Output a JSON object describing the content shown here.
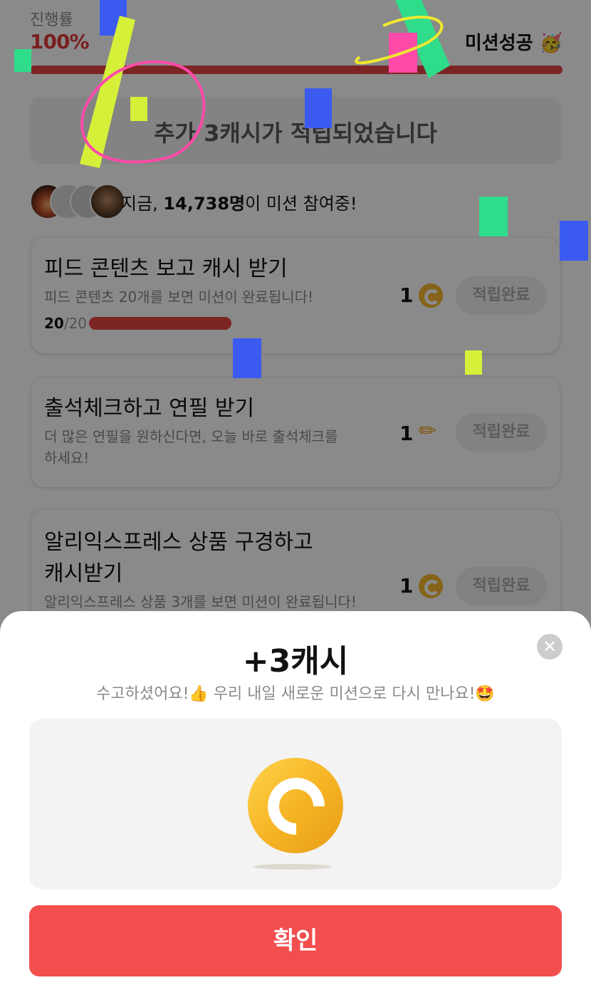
{
  "header": {
    "progress_label": "진행률",
    "progress_value": "100%",
    "progress_fraction": 1.0,
    "mission_status": "미션성공",
    "mission_status_emoji": "🥳"
  },
  "notice": {
    "text": "추가 3캐시가 적립되었습니다"
  },
  "participants": {
    "prefix": "지금, ",
    "count": "14,738명",
    "suffix": "이 미션 참여중!"
  },
  "missions": [
    {
      "title": "피드 콘텐츠 보고 캐시 받기",
      "description": "피드 콘텐츠 20개를 보면 미션이 완료됩니다!",
      "progress_done": "20",
      "progress_total": "/20",
      "progress_fraction": 1.0,
      "reward_amount": "1",
      "reward_icon": "cash-coin-icon",
      "button_label": "적립완료"
    },
    {
      "title": "출석체크하고 연필 받기",
      "description_line1": "더 많은 연필을 원하신다면, 오늘 바로 출석체크를",
      "description_line2": "하세요!",
      "reward_amount": "1",
      "reward_icon": "pencil-icon",
      "button_label": "적립완료"
    },
    {
      "title_line1": "알리익스프레스 상품 구경하고",
      "title_line2": "캐시받기",
      "description": "알리익스프레스 상품 3개를 보면 미션이 완료됩니다!",
      "reward_amount": "1",
      "reward_icon": "cash-coin-icon",
      "button_label": "적립완료"
    }
  ],
  "sheet": {
    "title": "+3캐시",
    "subtitle": "수고하셨어요!👍 우리 내일 새로운 미션으로 다시 만나요!🤩",
    "close_icon": "close-icon",
    "reward_icon": "cash-coin-icon",
    "confirm_label": "확인"
  },
  "colors": {
    "accent": "#f24e4e",
    "progress": "#e64545",
    "coin": "#f5b323",
    "overlay": "rgba(0,0,0,0.46)"
  }
}
